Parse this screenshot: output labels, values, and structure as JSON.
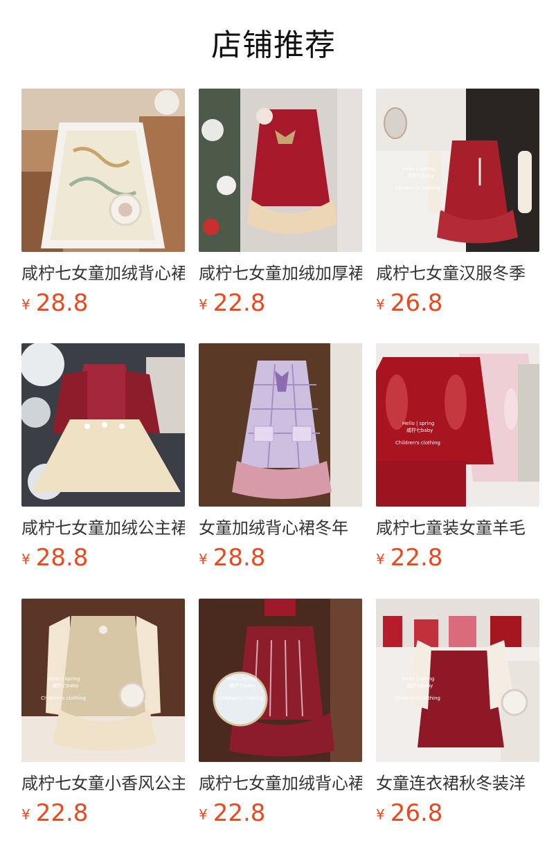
{
  "section": {
    "title": "店铺推荐"
  },
  "currency_symbol": "¥",
  "colors": {
    "price": "#e8491d",
    "title": "#111111",
    "name": "#333333"
  },
  "watermark": {
    "line1": "Hello  |  spring",
    "line2": "咸柠七baby",
    "line3": "Children's clothing"
  },
  "products": [
    {
      "name": "咸柠七女童加绒背心裙冬季",
      "price": "28.8"
    },
    {
      "name": "咸柠七女童加绒加厚裙",
      "price": "22.8"
    },
    {
      "name": "咸柠七女童汉服冬季",
      "price": "26.8"
    },
    {
      "name": "咸柠七女童加绒公主裙",
      "price": "28.8"
    },
    {
      "name": "女童加绒背心裙冬年",
      "price": "28.8"
    },
    {
      "name": "咸柠七童装女童羊毛",
      "price": "22.8"
    },
    {
      "name": "咸柠七女童小香风公主",
      "price": "22.8"
    },
    {
      "name": "咸柠七女童加绒背心裙",
      "price": "22.8"
    },
    {
      "name": "女童连衣裙秋冬装洋",
      "price": "26.8"
    }
  ]
}
